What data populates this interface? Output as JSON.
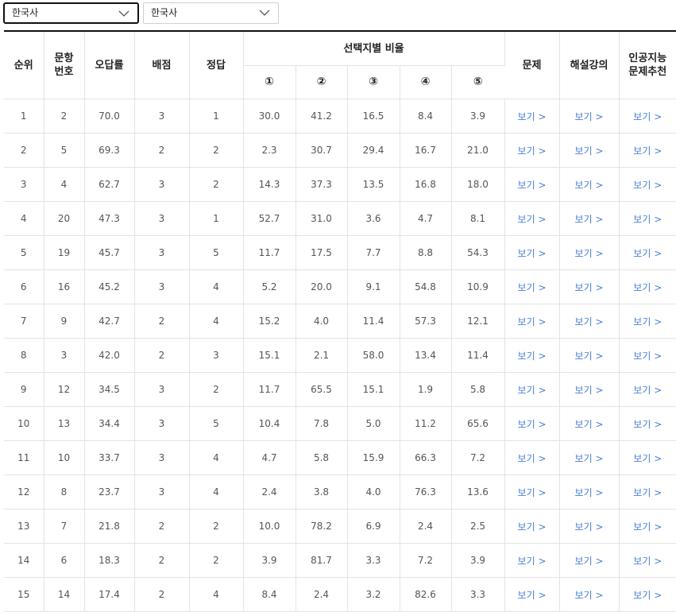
{
  "filters": {
    "subject_1": "한국사",
    "subject_2": "한국사"
  },
  "table": {
    "headers": {
      "rank": "순위",
      "q_no_line1": "문항",
      "q_no_line2": "번호",
      "wrong_rate": "오답률",
      "points": "배점",
      "answer": "정답",
      "choice_ratio": "선택지별 비율",
      "opt1": "①",
      "opt2": "②",
      "opt3": "③",
      "opt4": "④",
      "opt5": "⑤",
      "question": "문제",
      "lecture": "해설강의",
      "ai_line1": "인공지능",
      "ai_line2": "문제추천"
    },
    "view_label": "보기 >",
    "rows": [
      {
        "rank": "1",
        "q": "2",
        "rate": "70.0",
        "pts": "3",
        "ans": "1",
        "o1": "30.0",
        "o2": "41.2",
        "o3": "16.5",
        "o4": "8.4",
        "o5": "3.9"
      },
      {
        "rank": "2",
        "q": "5",
        "rate": "69.3",
        "pts": "2",
        "ans": "2",
        "o1": "2.3",
        "o2": "30.7",
        "o3": "29.4",
        "o4": "16.7",
        "o5": "21.0"
      },
      {
        "rank": "3",
        "q": "4",
        "rate": "62.7",
        "pts": "3",
        "ans": "2",
        "o1": "14.3",
        "o2": "37.3",
        "o3": "13.5",
        "o4": "16.8",
        "o5": "18.0"
      },
      {
        "rank": "4",
        "q": "20",
        "rate": "47.3",
        "pts": "3",
        "ans": "1",
        "o1": "52.7",
        "o2": "31.0",
        "o3": "3.6",
        "o4": "4.7",
        "o5": "8.1"
      },
      {
        "rank": "5",
        "q": "19",
        "rate": "45.7",
        "pts": "3",
        "ans": "5",
        "o1": "11.7",
        "o2": "17.5",
        "o3": "7.7",
        "o4": "8.8",
        "o5": "54.3"
      },
      {
        "rank": "6",
        "q": "16",
        "rate": "45.2",
        "pts": "3",
        "ans": "4",
        "o1": "5.2",
        "o2": "20.0",
        "o3": "9.1",
        "o4": "54.8",
        "o5": "10.9"
      },
      {
        "rank": "7",
        "q": "9",
        "rate": "42.7",
        "pts": "2",
        "ans": "4",
        "o1": "15.2",
        "o2": "4.0",
        "o3": "11.4",
        "o4": "57.3",
        "o5": "12.1"
      },
      {
        "rank": "8",
        "q": "3",
        "rate": "42.0",
        "pts": "2",
        "ans": "3",
        "o1": "15.1",
        "o2": "2.1",
        "o3": "58.0",
        "o4": "13.4",
        "o5": "11.4"
      },
      {
        "rank": "9",
        "q": "12",
        "rate": "34.5",
        "pts": "3",
        "ans": "2",
        "o1": "11.7",
        "o2": "65.5",
        "o3": "15.1",
        "o4": "1.9",
        "o5": "5.8"
      },
      {
        "rank": "10",
        "q": "13",
        "rate": "34.4",
        "pts": "3",
        "ans": "5",
        "o1": "10.4",
        "o2": "7.8",
        "o3": "5.0",
        "o4": "11.2",
        "o5": "65.6"
      },
      {
        "rank": "11",
        "q": "10",
        "rate": "33.7",
        "pts": "3",
        "ans": "4",
        "o1": "4.7",
        "o2": "5.8",
        "o3": "15.9",
        "o4": "66.3",
        "o5": "7.2"
      },
      {
        "rank": "12",
        "q": "8",
        "rate": "23.7",
        "pts": "3",
        "ans": "4",
        "o1": "2.4",
        "o2": "3.8",
        "o3": "4.0",
        "o4": "76.3",
        "o5": "13.6"
      },
      {
        "rank": "13",
        "q": "7",
        "rate": "21.8",
        "pts": "2",
        "ans": "2",
        "o1": "10.0",
        "o2": "78.2",
        "o3": "6.9",
        "o4": "2.4",
        "o5": "2.5"
      },
      {
        "rank": "14",
        "q": "6",
        "rate": "18.3",
        "pts": "2",
        "ans": "2",
        "o1": "3.9",
        "o2": "81.7",
        "o3": "3.3",
        "o4": "7.2",
        "o5": "3.9"
      },
      {
        "rank": "15",
        "q": "14",
        "rate": "17.4",
        "pts": "2",
        "ans": "4",
        "o1": "8.4",
        "o2": "2.4",
        "o3": "3.2",
        "o4": "82.6",
        "o5": "3.3"
      }
    ]
  },
  "colors": {
    "link": "#4a7fd4",
    "header_rule": "#111111",
    "grid_line": "#e3e3e3"
  }
}
